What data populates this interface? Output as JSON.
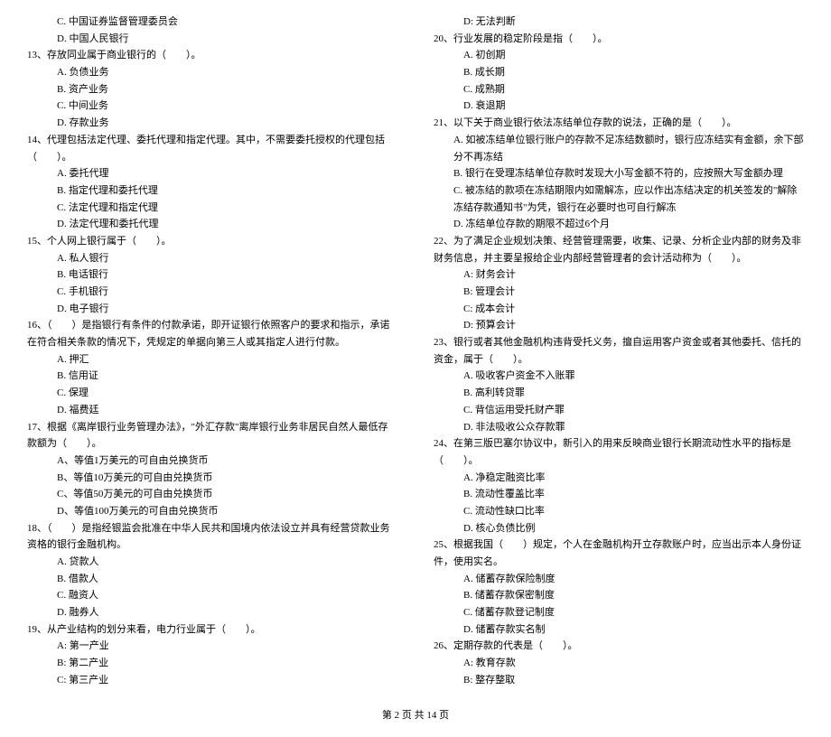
{
  "left_column": {
    "pre_options": [
      "C. 中国证券监督管理委员会",
      "D. 中国人民银行"
    ],
    "q13": {
      "stem": "13、存放同业属于商业银行的（　　）。",
      "opts": [
        "A. 负债业务",
        "B. 资产业务",
        "C. 中间业务",
        "D. 存款业务"
      ]
    },
    "q14": {
      "stem": "14、代理包括法定代理、委托代理和指定代理。其中，不需要委托授权的代理包括（　　）。",
      "opts": [
        "A. 委托代理",
        "B. 指定代理和委托代理",
        "C. 法定代理和指定代理",
        "D. 法定代理和委托代理"
      ]
    },
    "q15": {
      "stem": "15、个人网上银行属于（　　）。",
      "opts": [
        "A. 私人银行",
        "B. 电话银行",
        "C. 手机银行",
        "D. 电子银行"
      ]
    },
    "q16": {
      "stem": "16、（　　）是指银行有条件的付款承诺，即开证银行依照客户的要求和指示，承诺在符合相关条款的情况下，凭规定的单据向第三人或其指定人进行付款。",
      "opts": [
        "A. 押汇",
        "B. 信用证",
        "C. 保理",
        "D. 福费廷"
      ]
    },
    "q17": {
      "stem": "17、根据《离岸银行业务管理办法》，\"外汇存款\"离岸银行业务非居民自然人最低存款额为（　　）。",
      "opts": [
        "A、等值1万美元的可自由兑换货币",
        "B、等值10万美元的可自由兑换货币",
        "C、等值50万美元的可自由兑换货币",
        "D、等值100万美元的可自由兑换货币"
      ]
    },
    "q18": {
      "stem": "18、（　　）是指经银监会批准在中华人民共和国境内依法设立并具有经营贷款业务资格的银行金融机构。",
      "opts": [
        "A. 贷款人",
        "B. 借款人",
        "C. 融资人",
        "D. 融券人"
      ]
    },
    "q19": {
      "stem": "19、从产业结构的划分来看，电力行业属于（　　）。",
      "opts": [
        "A: 第一产业",
        "B: 第二产业",
        "C: 第三产业"
      ]
    }
  },
  "right_column": {
    "pre_options": [
      "D: 无法判断"
    ],
    "q20": {
      "stem": "20、行业发展的稳定阶段是指（　　）。",
      "opts": [
        "A. 初创期",
        "B. 成长期",
        "C. 成熟期",
        "D. 衰退期"
      ]
    },
    "q21": {
      "stem": "21、以下关于商业银行依法冻结单位存款的说法，正确的是（　　）。",
      "opts": [
        "A. 如被冻结单位银行账户的存款不足冻结数额时，银行应冻结实有金额，余下部分不再冻结",
        "B. 银行在受理冻结单位存款时发现大小写金额不符的，应按照大写金额办理",
        "C. 被冻结的款项在冻结期限内如需解冻，应以作出冻结决定的机关签发的\"解除冻结存款通知书\"为凭，银行在必要时也可自行解冻",
        "D. 冻结单位存款的期限不超过6个月"
      ]
    },
    "q22": {
      "stem": "22、为了满足企业规划决策、经营管理需要，收集、记录、分析企业内部的财务及非财务信息，并主要呈报给企业内部经营管理者的会计活动称为（　　）。",
      "opts": [
        "A: 财务会计",
        "B: 管理会计",
        "C: 成本会计",
        "D: 预算会计"
      ]
    },
    "q23": {
      "stem": "23、银行或者其他金融机构违背受托义务，擅自运用客户资金或者其他委托、信托的资金，属于（　　）。",
      "opts": [
        "A. 吸收客户资金不入账罪",
        "B. 高利转贷罪",
        "C. 背信运用受托财产罪",
        "D. 非法吸收公众存款罪"
      ]
    },
    "q24": {
      "stem": "24、在第三版巴塞尔协议中，新引入的用来反映商业银行长期流动性水平的指标是（　　）。",
      "opts": [
        "A. 净稳定融资比率",
        "B. 流动性覆盖比率",
        "C. 流动性缺口比率",
        "D. 核心负债比例"
      ]
    },
    "q25": {
      "stem": "25、根据我国（　　）规定，个人在金融机构开立存款账户时，应当出示本人身份证件，使用实名。",
      "opts": [
        "A. 储蓄存款保险制度",
        "B. 储蓄存款保密制度",
        "C. 储蓄存款登记制度",
        "D. 储蓄存款实名制"
      ]
    },
    "q26": {
      "stem": "26、定期存款的代表是（　　）。",
      "opts": [
        "A: 教育存款",
        "B: 整存整取"
      ]
    }
  },
  "footer": "第 2 页 共 14 页"
}
